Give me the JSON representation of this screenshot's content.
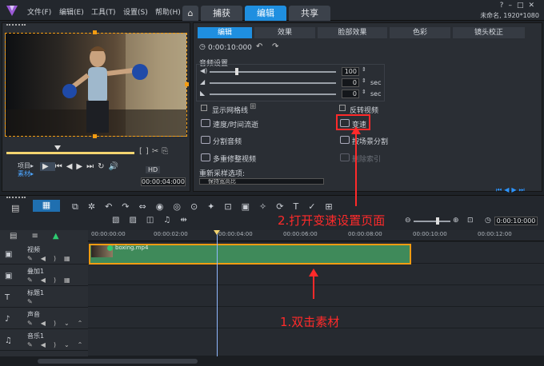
{
  "menu": [
    "文件(F)",
    "编辑(E)",
    "工具(T)",
    "设置(S)",
    "帮助(H)"
  ],
  "top_tabs": [
    "捕获",
    "编辑",
    "共享"
  ],
  "project_info": "未命名, 1920*1080",
  "preview": {
    "project_label": "项目▸",
    "clip_label": "素材▸",
    "timecode": "00:00:04:000",
    "scale": "HD"
  },
  "options": {
    "tabs": [
      "编辑",
      "效果",
      "脸部效果",
      "色彩",
      "镜头校正"
    ],
    "duration": "0:00:10:000",
    "audio_settings": "音频设置",
    "audio_rows": [
      {
        "value": "100",
        "unit": ""
      },
      {
        "value": "0",
        "unit": "sec"
      },
      {
        "value": "0",
        "unit": "sec"
      }
    ],
    "show_grid": "显示网格线",
    "reverse_video": "反转视频",
    "speed_time": "速度/时间流逝",
    "speed_change": "变速",
    "split_audio": "分割音频",
    "split_by_scene": "按场景分割",
    "multi_trim": "多重修整视频",
    "remove_index": "删除索引",
    "resample_label": "重新采样选项:",
    "resample_value": "保持宽高比"
  },
  "timeline": {
    "ruler": [
      "00:00:00:00",
      "00:00:02:00",
      "00:00:04:00",
      "00:00:06:00",
      "00:00:08:00",
      "00:00:10:00",
      "00:00:12:00"
    ],
    "timecode": "0:00:10:000",
    "tracks": [
      "视频",
      "叠加1",
      "标题1",
      "声音",
      "音乐1"
    ],
    "clip_name": "boxing.mp4"
  },
  "annotations": {
    "step1": "1.双击素材",
    "step2": "2.打开变速设置页面"
  },
  "colors": {
    "accent": "#1f8fe0",
    "annotation": "#ff2a2a",
    "clip": "#3f8a5a",
    "selection": "#f39c12"
  }
}
